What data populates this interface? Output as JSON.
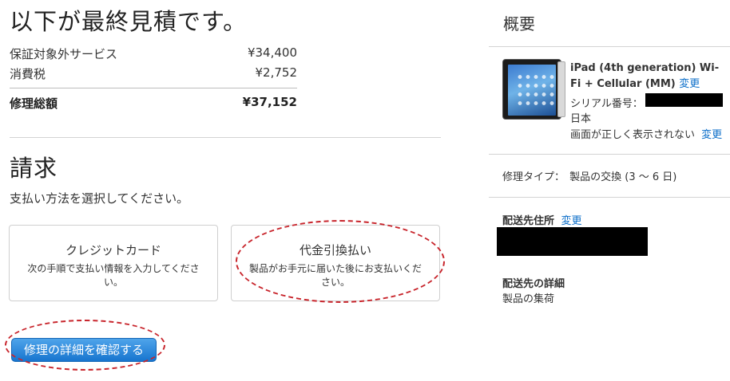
{
  "quote": {
    "title": "以下が最終見積です。",
    "items": [
      {
        "label": "保証対象外サービス",
        "amount": "¥34,400"
      },
      {
        "label": "消費税",
        "amount": "¥2,752"
      }
    ],
    "total_label": "修理総額",
    "total_amount": "¥37,152"
  },
  "billing": {
    "title": "請求",
    "prompt": "支払い方法を選択してください。",
    "options": [
      {
        "title": "クレジットカード",
        "desc": "次の手順で支払い情報を入力してください。"
      },
      {
        "title": "代金引換払い",
        "desc": "製品がお手元に届いた後にお支払いください。"
      }
    ],
    "confirm_button": "修理の詳細を確認する"
  },
  "summary": {
    "title": "概要",
    "product_name": "iPad (4th generation) Wi-Fi + Cellular (MM)",
    "change_label": "変更",
    "serial_label": "シリアル番号：",
    "country": "日本",
    "issue": "画面が正しく表示されない",
    "repair_type_label": "修理タイプ：",
    "repair_type_value": "製品の交換 (3 ～ 6 日)",
    "shipping_address_label": "配送先住所",
    "shipping_detail_label": "配送先の詳細",
    "shipping_detail_value": "製品の集荷"
  },
  "colors": {
    "link": "#0b6ec9",
    "button": "#1775cf",
    "annotation": "#c8252c"
  },
  "icons": {
    "product": "ipad-thumbnail"
  }
}
